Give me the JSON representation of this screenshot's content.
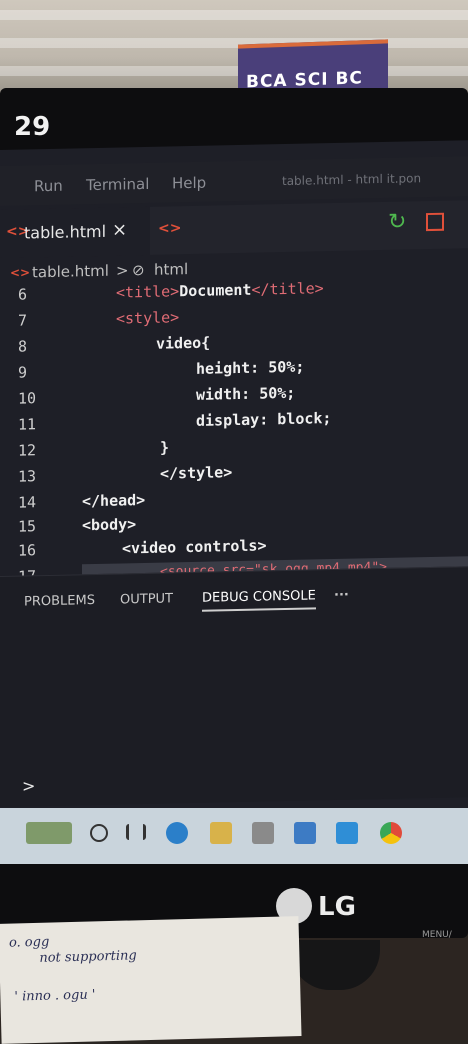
{
  "sticker_text": "BCA SCI BC 29",
  "monitor_label": "29",
  "menu": {
    "run": "Run",
    "terminal": "Terminal",
    "help": "Help",
    "window_title": "table.html - html it.pon"
  },
  "tab": {
    "icon": "<>",
    "label": "table.html",
    "close": "×",
    "second_icon": "<>"
  },
  "breadcrumb": {
    "icon": "<>",
    "file": "table.html",
    "sep": ">",
    "item_icon": "⊘",
    "item": "html"
  },
  "code_lines": [
    {
      "n": "6",
      "html": "<title>Document</title>"
    },
    {
      "n": "7",
      "text": "<style>"
    },
    {
      "n": "8",
      "text": "video{"
    },
    {
      "n": "9",
      "text": "height: 50%;"
    },
    {
      "n": "10",
      "text": "width: 50%;"
    },
    {
      "n": "11",
      "text": "display: block;"
    },
    {
      "n": "12",
      "text": "}"
    },
    {
      "n": "13",
      "text": "</style>"
    },
    {
      "n": "14",
      "text": "</head>"
    },
    {
      "n": "15",
      "text": "<body>"
    },
    {
      "n": "16",
      "text": "<video controls>"
    },
    {
      "n": "17",
      "text": "<source src=\"sk.ogg.mp4.mp4\">"
    }
  ],
  "panel_tabs": [
    "PROBLEMS",
    "OUTPUT",
    "DEBUG CONSOLE",
    "···"
  ],
  "console_prompt": ">",
  "taskbar_icons": [
    "search-icon",
    "task-view-icon",
    "edge-icon",
    "file-explorer-icon",
    "store-icon",
    "mail-icon",
    "vscode-icon",
    "chrome-icon"
  ],
  "brand": "LG",
  "bezel_menu": "MENU/",
  "handwriting": [
    "o. ogg",
    "not supporting",
    "' inno . ogu '"
  ],
  "colors": {
    "tag": "#e06c75",
    "accent_orange": "#e0503a",
    "green": "#4fb84f"
  }
}
